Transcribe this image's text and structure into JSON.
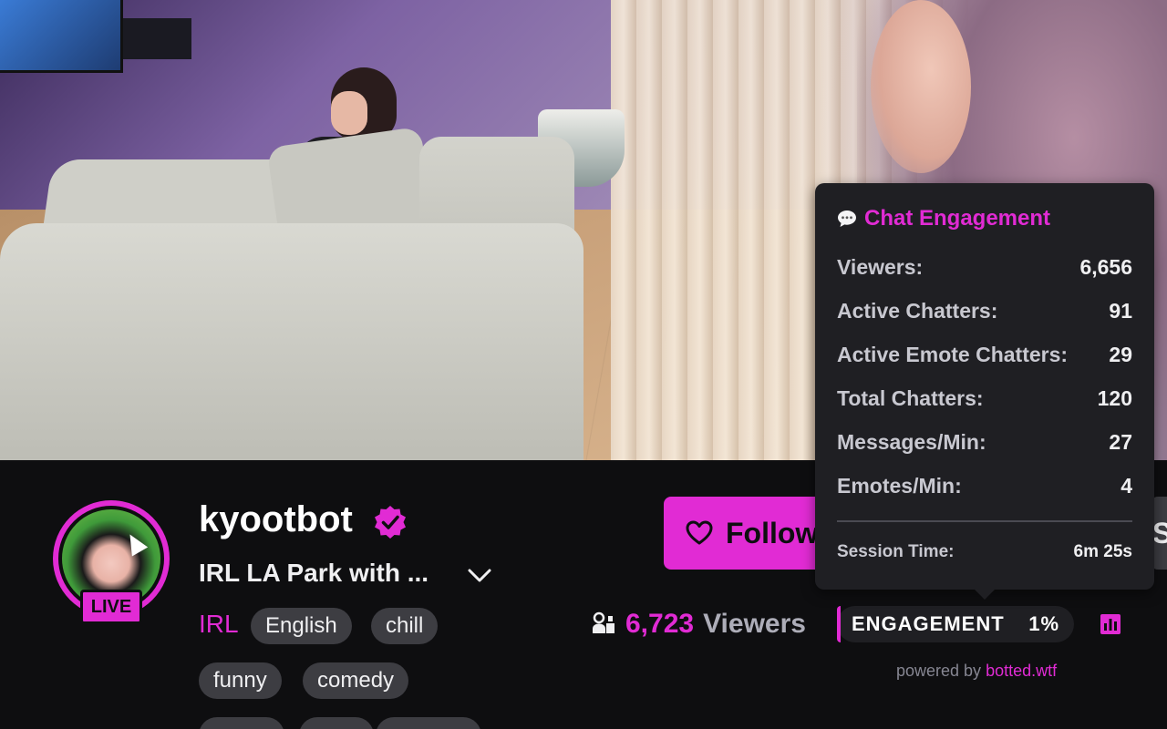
{
  "channel": {
    "name": "kyootbot",
    "live_label": "LIVE",
    "stream_title": "IRL LA Park with ...",
    "category": "IRL",
    "tags": [
      "English",
      "chill",
      "funny",
      "comedy"
    ]
  },
  "actions": {
    "follow_label": "Follow",
    "subscribe_label": "Su"
  },
  "viewers": {
    "count": "6,723",
    "label": "Viewers"
  },
  "engagement": {
    "label": "ENGAGEMENT",
    "value": "1%",
    "powered_prefix": "powered by",
    "powered_link": "botted.wtf"
  },
  "tooltip": {
    "title": "Chat Engagement",
    "stats": [
      {
        "label": "Viewers:",
        "value": "6,656"
      },
      {
        "label": "Active Chatters:",
        "value": "91"
      },
      {
        "label": "Active Emote Chatters:",
        "value": "29"
      },
      {
        "label": "Total Chatters:",
        "value": "120"
      },
      {
        "label": "Messages/Min:",
        "value": "27"
      },
      {
        "label": "Emotes/Min:",
        "value": "4"
      }
    ],
    "session_label": "Session Time:",
    "session_value": "6m 25s"
  },
  "colors": {
    "accent": "#e12bd4",
    "background": "#0e0e10",
    "tag_bg": "#3d3d42",
    "tooltip_bg": "#1f1f23"
  },
  "icons": [
    "verified-icon",
    "chevron-down-icon",
    "heart-icon",
    "viewers-icon",
    "speech-bubble-icon",
    "stats-icon"
  ]
}
